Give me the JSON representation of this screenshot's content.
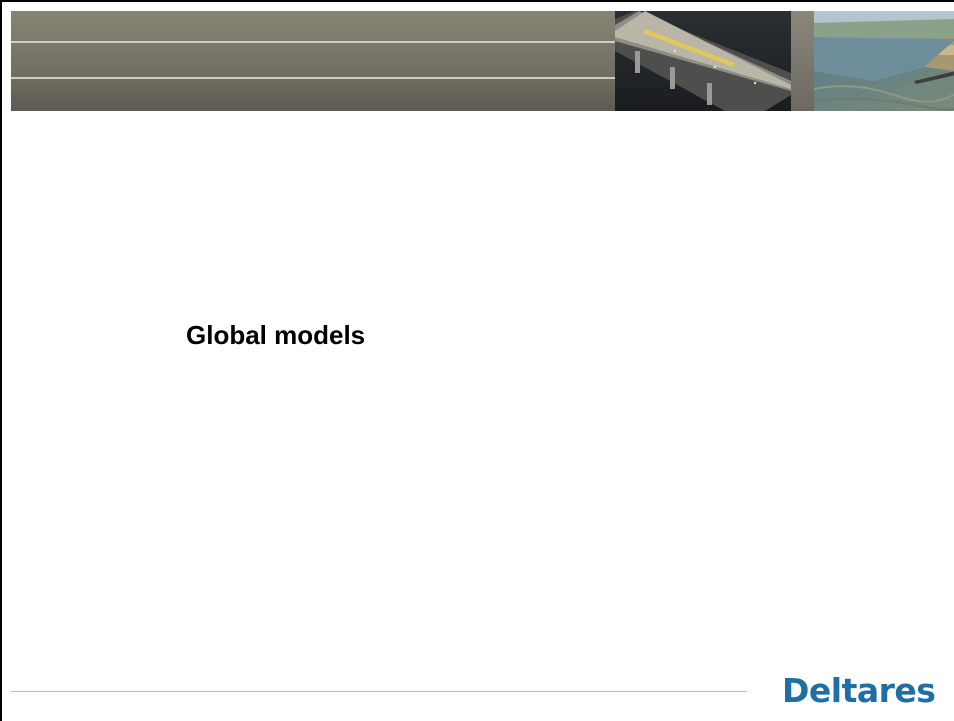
{
  "slide": {
    "title": "Global models"
  },
  "branding": {
    "logo_text": "Deltares",
    "logo_color": "#1f6fa6"
  },
  "header": {
    "images": [
      {
        "name": "bridge-photo"
      },
      {
        "name": "river-aerial-photo"
      }
    ]
  }
}
